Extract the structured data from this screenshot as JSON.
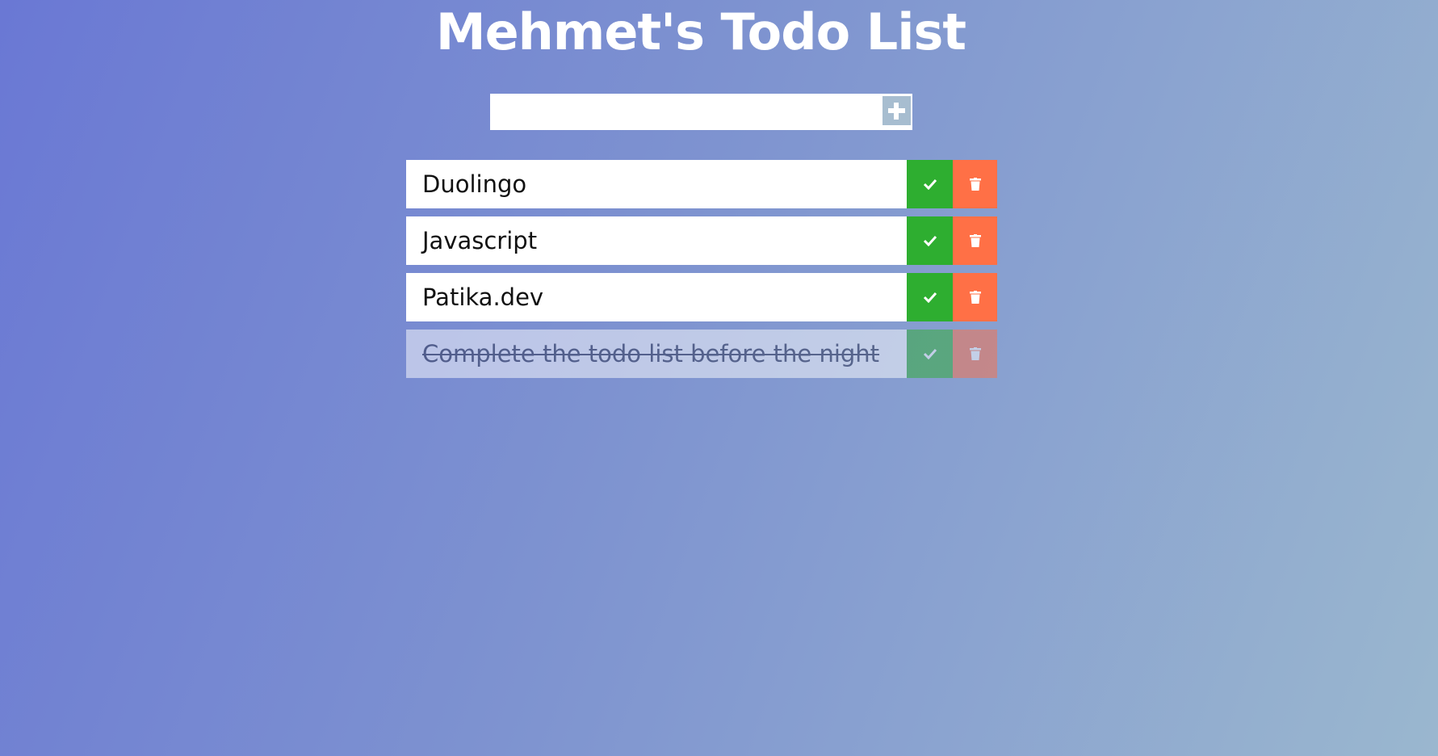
{
  "header": {
    "title": "Mehmet's Todo List"
  },
  "add_form": {
    "input_value": "",
    "input_placeholder": "",
    "add_icon": "plus-icon"
  },
  "todos": [
    {
      "text": "Duolingo",
      "completed": false
    },
    {
      "text": "Javascript",
      "completed": false
    },
    {
      "text": "Patika.dev",
      "completed": false
    },
    {
      "text": "Complete the todo list before the night",
      "completed": true
    }
  ],
  "icons": {
    "complete": "check-icon",
    "delete": "trash-icon"
  },
  "colors": {
    "complete_button": "#2eae30",
    "delete_button": "#ff7046",
    "add_button": "#a7bdd0",
    "background_start": "#6a78d4",
    "background_end": "#9ab7cf"
  }
}
